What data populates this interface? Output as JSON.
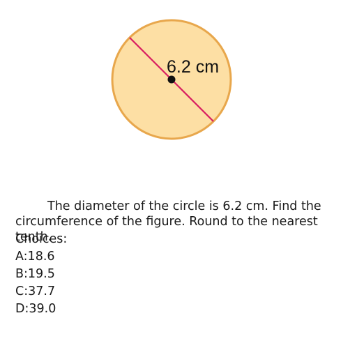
{
  "figure": {
    "diameter_label": "6.2 cm",
    "colors": {
      "circle_fill": "#fddfa4",
      "circle_stroke": "#e8a74c",
      "diameter_line": "#d81b60",
      "center_dot": "#111111"
    }
  },
  "question": {
    "text": "The diameter of the circle is 6.2 cm. Find the circumference of the figure. Round to the nearest tenth.",
    "choices_label": "Choices:",
    "choices": [
      "A:18.6",
      "B:19.5",
      "C:37.7",
      "D:39.0"
    ]
  }
}
